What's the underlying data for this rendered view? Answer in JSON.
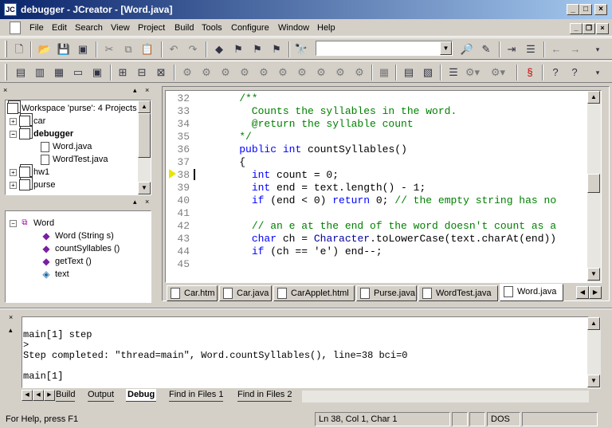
{
  "window": {
    "title": "debugger - JCreator - [Word.java]",
    "minimize": "_",
    "maximize": "□",
    "close": "×"
  },
  "menu": [
    "File",
    "Edit",
    "Search",
    "View",
    "Project",
    "Build",
    "Tools",
    "Configure",
    "Window",
    "Help"
  ],
  "toolbar": {
    "find_value": ""
  },
  "workspace": {
    "header": "Workspace 'purse': 4 Projects",
    "items": [
      {
        "label": "car",
        "bold": false
      },
      {
        "label": "debugger",
        "bold": true
      },
      {
        "label": "Word.java",
        "bold": false
      },
      {
        "label": "WordTest.java",
        "bold": false
      },
      {
        "label": "hw1",
        "bold": false
      },
      {
        "label": "purse",
        "bold": false
      }
    ]
  },
  "classview": {
    "class_name": "Word",
    "members": [
      {
        "label": "Word (String s)",
        "kind": "method"
      },
      {
        "label": "countSyllables ()",
        "kind": "method"
      },
      {
        "label": "getText ()",
        "kind": "method"
      },
      {
        "label": "text",
        "kind": "field"
      }
    ]
  },
  "editor": {
    "lines": [
      {
        "n": "32",
        "text": "    /**"
      },
      {
        "n": "33",
        "text": "      Counts the syllables in the word."
      },
      {
        "n": "34",
        "text": "      @return the syllable count"
      },
      {
        "n": "35",
        "text": "    */"
      },
      {
        "n": "36",
        "text": "    public int countSyllables()"
      },
      {
        "n": "37",
        "text": "    {"
      },
      {
        "n": "38",
        "text": "      int count = 0;"
      },
      {
        "n": "39",
        "text": "      int end = text.length() - 1;"
      },
      {
        "n": "40",
        "text": "      if (end < 0) return 0; // the empty string has no"
      },
      {
        "n": "41",
        "text": ""
      },
      {
        "n": "42",
        "text": "      // an e at the end of the word doesn't count as a"
      },
      {
        "n": "43",
        "text": "      char ch = Character.toLowerCase(text.charAt(end))"
      },
      {
        "n": "44",
        "text": "      if (ch == 'e') end--;"
      },
      {
        "n": "45",
        "text": ""
      }
    ],
    "current_line": "38"
  },
  "editor_tabs": [
    "Car.htm",
    "Car.java",
    "CarApplet.html",
    "Purse.java",
    "WordTest.java",
    "Word.java"
  ],
  "active_editor_tab": "Word.java",
  "output": {
    "lines": [
      "",
      "main[1] step",
      ">",
      "Step completed: \"thread=main\", Word.countSyllables(), line=38 bci=0",
      "",
      "main[1]"
    ]
  },
  "output_tabs": [
    "Build",
    "Output",
    "Debug",
    "Find in Files 1",
    "Find in Files 2"
  ],
  "active_output_tab": "Debug",
  "status": {
    "help": "For Help, press F1",
    "position": "Ln 38, Col 1, Char 1",
    "mode": "DOS"
  }
}
